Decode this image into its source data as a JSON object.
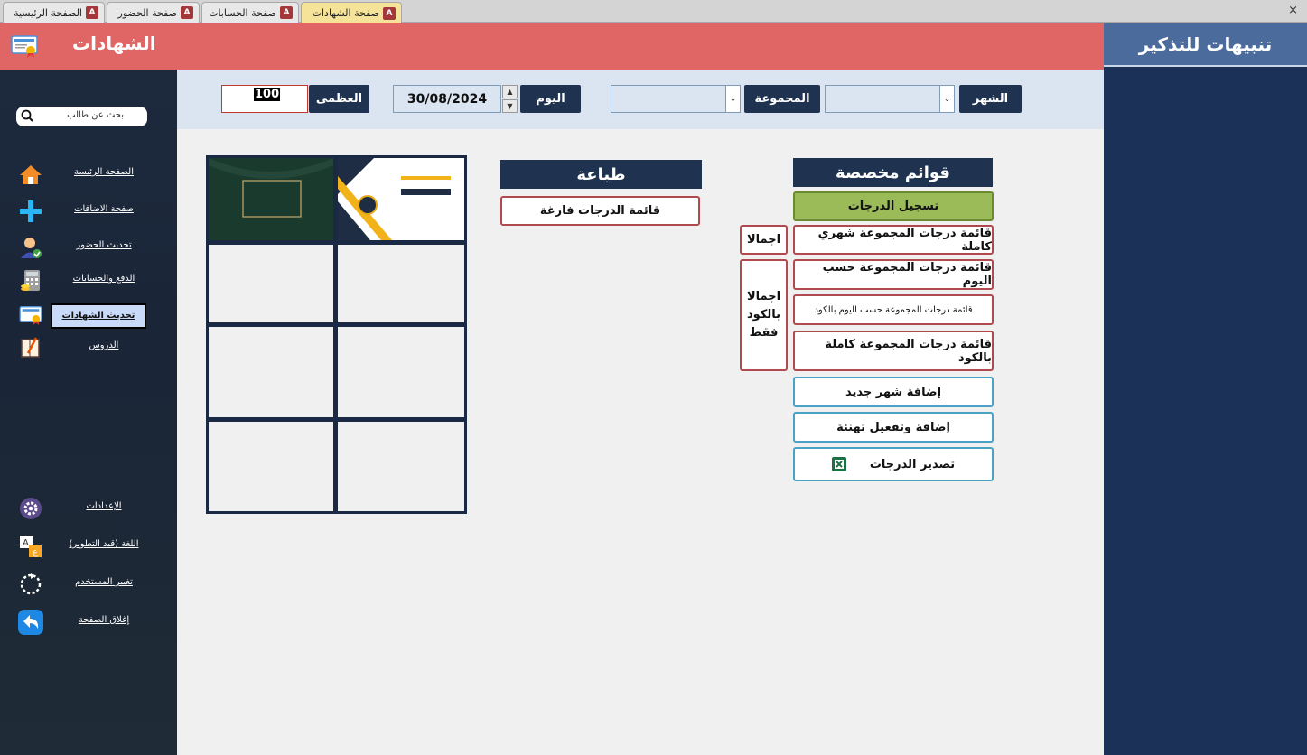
{
  "tabs": [
    {
      "label": "صفحة الشهادات",
      "active": true
    },
    {
      "label": "صفحة الحسابات",
      "active": false
    },
    {
      "label": "صفحة الحضور",
      "active": false
    },
    {
      "label": "الصفحة الرئيسية",
      "active": false
    }
  ],
  "window": {
    "close": "×"
  },
  "header": {
    "title": "الشهادات"
  },
  "search": {
    "placeholder": "بحث عن طالب"
  },
  "sidebar": {
    "items": [
      {
        "label": "الصفحة الرئيسة",
        "icon": "home-icon"
      },
      {
        "label": "صفحة الاضافات",
        "icon": "plus-icon"
      },
      {
        "label": "تحديث الحضور",
        "icon": "attendance-icon"
      },
      {
        "label": "الدفع والحسابات",
        "icon": "calculator-icon"
      },
      {
        "label": "تحديث الشهادات",
        "icon": "certificate-icon",
        "selected": true
      },
      {
        "label": "الدروس",
        "icon": "book-icon"
      }
    ],
    "bottom_items": [
      {
        "label": "الإعدادات",
        "icon": "gear-icon"
      },
      {
        "label": "اللغة (قيد التطوير)",
        "icon": "language-icon"
      },
      {
        "label": "تغيير المستخدم",
        "icon": "refresh-icon"
      },
      {
        "label": "إغلاق الصفحة",
        "icon": "back-arrow-icon"
      }
    ]
  },
  "filters": {
    "month_label": "الشهر",
    "group_label": "المجموعة",
    "day_label": "اليوم",
    "date_value": "30/08/2024",
    "max_label": "العظمى",
    "max_value": "100"
  },
  "lists": {
    "title": "قوائم مخصصة",
    "register_grades": "تسجيل الدرجات",
    "monthly_full": "قائمة درجات المجموعة شهري كاملة",
    "total": "اجمالا",
    "by_day": "قائمة درجات المجموعة حسب اليوم",
    "by_day_code": "قائمة درجات المجموعة حسب اليوم بالكود",
    "full_code": "قائمة درجات المجموعة كاملة بالكود",
    "total_code_only": "اجمالا بالكود فقط",
    "add_month": "إضافة شهر جديد",
    "add_congrats": "إضافة وتفعيل تهنئة",
    "export": "تصدير الدرجات"
  },
  "print": {
    "title": "طباعة",
    "empty_list": "قائمة الدرجات فارغة"
  },
  "reminders": {
    "title": "تنبيهات للتذكير"
  },
  "colors": {
    "header": "#e06666",
    "navy": "#1f3250",
    "sidebar": "#1d2a3e",
    "filter_bar": "#dbe5f1",
    "green_button": "#9bbb59",
    "reminder_panel": "#1b3157"
  }
}
